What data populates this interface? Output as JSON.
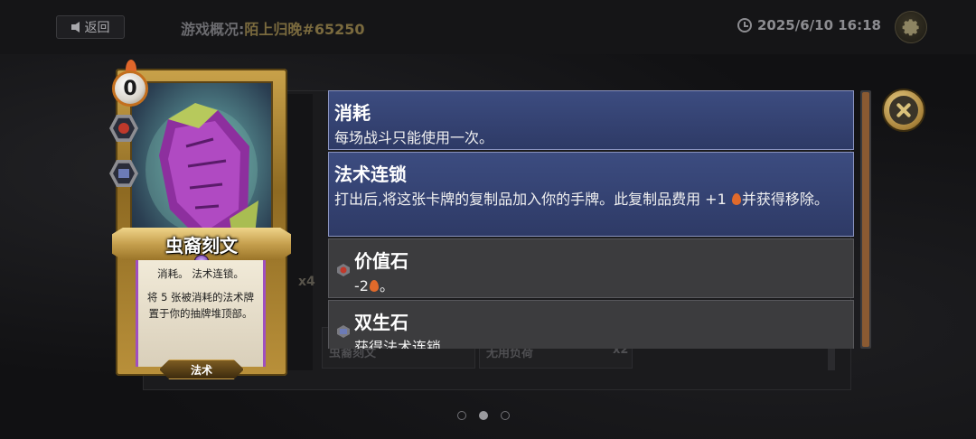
{
  "topbar": {
    "back_label": "返回",
    "overview_label": "游戏概况:",
    "game_id": "陌上归晚#65250",
    "datetime": "2025/6/10 16:18"
  },
  "background": {
    "count_badge": "x4",
    "tiles": [
      "虫裔刻文",
      "无用负荷"
    ],
    "tile_count": "x2"
  },
  "card": {
    "cost": "0",
    "name": "虫裔刻文",
    "keywords": "消耗。 法术连锁。",
    "effect": "将 5 张被消耗的法术牌置于你的抽牌堆顶部。",
    "type": "法术"
  },
  "tooltips": [
    {
      "title": "消耗",
      "desc": "每场战斗只能使用一次。",
      "style": "blue"
    },
    {
      "title": "法术连锁",
      "desc_pre": "打出后,将这张卡牌的复制品加入你的手牌。此复制品费用 +1",
      "desc_post": "并获得移除。",
      "style": "blue"
    },
    {
      "title": "价值石",
      "desc_pre": "-2",
      "desc_post": "。",
      "style": "grey",
      "icon": "value-stone-icon"
    },
    {
      "title": "双生石",
      "desc": "获得法术连锁",
      "style": "grey",
      "icon": "twin-stone-icon"
    }
  ],
  "pagination": {
    "pages": 3,
    "current": 2
  },
  "colors": {
    "accent_gold": "#c9a24a",
    "tooltip_blue": "#3c4c80",
    "tooltip_grey": "#3c3c3e",
    "flame": "#e06a2b"
  }
}
